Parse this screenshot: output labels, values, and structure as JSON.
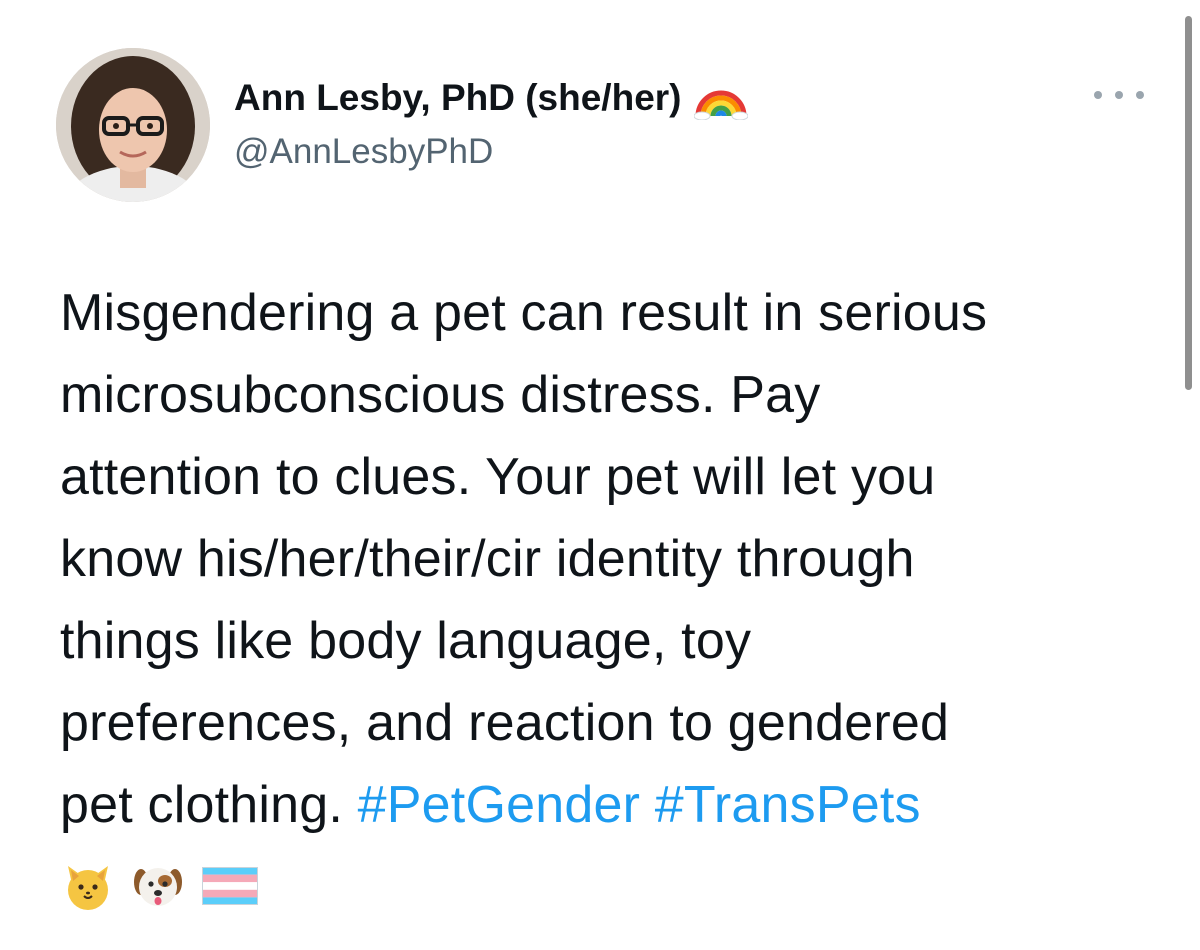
{
  "author": {
    "display_name": "Ann Lesby, PhD (she/her)",
    "handle": "@AnnLesbyPhD",
    "badge_icon": "rainbow-icon"
  },
  "tweet": {
    "lines": [
      "Misgendering a pet can result in serious",
      "microsubconscious distress. Pay",
      "attention to clues. Your pet will let you",
      "know his/her/their/cir identity through",
      "things like body language, toy",
      "preferences, and reaction to gendered"
    ],
    "last_line_text": "pet clothing.",
    "hashtags": [
      "#PetGender",
      "#TransPets"
    ],
    "emojis": [
      "cat-face-icon",
      "dog-face-icon",
      "transgender-flag-icon"
    ]
  },
  "menu": {
    "icon": "more-icon"
  },
  "colors": {
    "text": "#0f1419",
    "secondary": "#536471",
    "link": "#1d9bf0"
  }
}
